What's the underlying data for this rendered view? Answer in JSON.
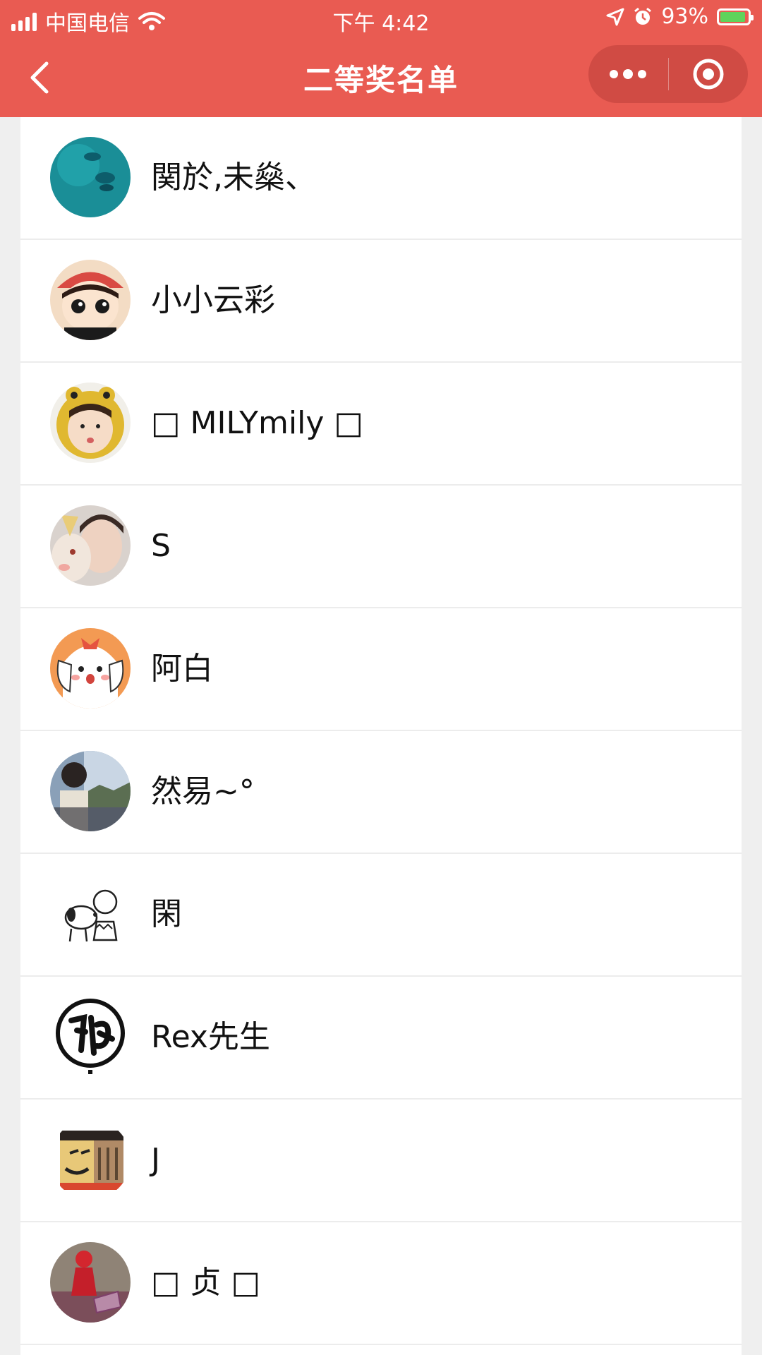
{
  "status_bar": {
    "carrier": "中国电信",
    "time": "下午 4:42",
    "battery": "93%",
    "battery_level": 0.93
  },
  "header": {
    "title": "二等奖名单",
    "back_icon": "chevron-left-icon",
    "more_icon": "more-dots-icon",
    "close_icon": "target-circle-icon"
  },
  "colors": {
    "accent": "#e95b52",
    "list_bg": "#ffffff",
    "page_bg": "#efefef"
  },
  "winners": [
    {
      "name": "関於,未燊、",
      "avatar": "teal-water-avatar"
    },
    {
      "name": "小小云彩",
      "avatar": "cartoon-girl-red-hat-avatar"
    },
    {
      "name": "□ MILYmily □",
      "avatar": "girl-yellow-frog-hat-avatar"
    },
    {
      "name": "S",
      "avatar": "girl-with-plush-avatar"
    },
    {
      "name": "阿白",
      "avatar": "cartoon-puppy-avatar"
    },
    {
      "name": "然易~°",
      "avatar": "boy-by-window-avatar"
    },
    {
      "name": "閑",
      "avatar": "snoopy-charlie-avatar"
    },
    {
      "name": "Rex先生",
      "avatar": "calligraphy-seal-avatar"
    },
    {
      "name": "J",
      "avatar": "tiki-mask-avatar"
    },
    {
      "name": "□ 贞 □",
      "avatar": "red-figure-photo-avatar"
    }
  ]
}
